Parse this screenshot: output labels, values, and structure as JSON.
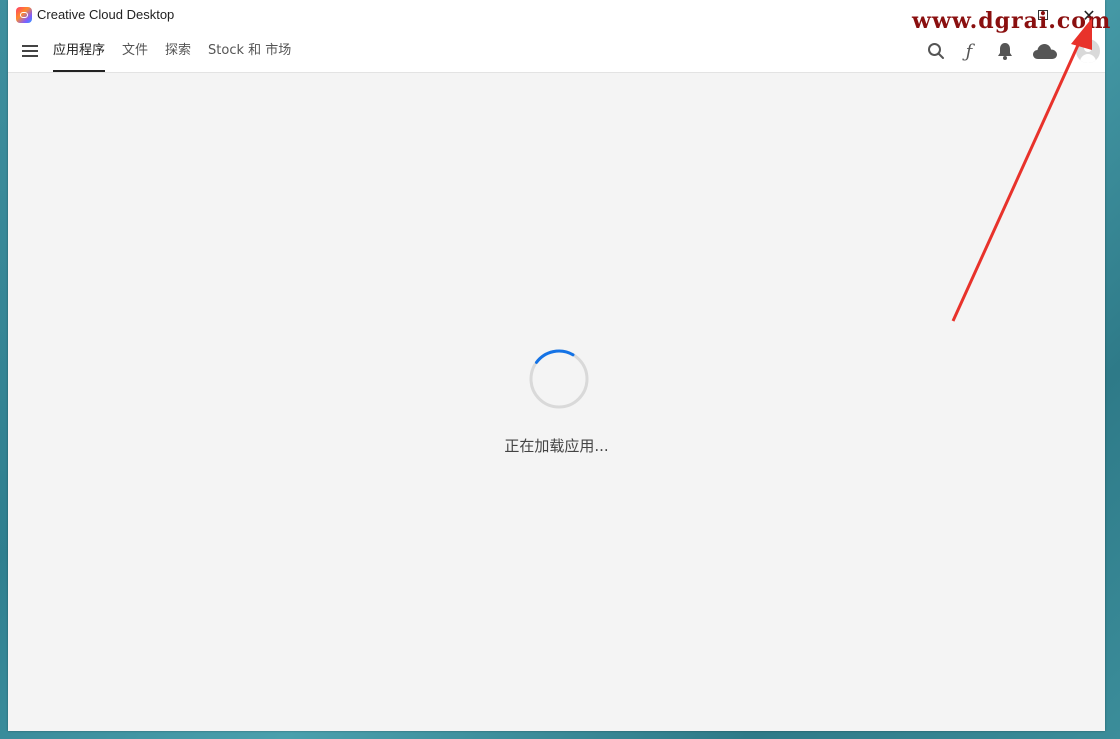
{
  "window": {
    "title": "Creative Cloud Desktop",
    "watermark": "www.dgrai.com"
  },
  "nav": {
    "tabs": [
      {
        "label": "应用程序",
        "active": true
      },
      {
        "label": "文件",
        "active": false
      },
      {
        "label": "探索",
        "active": false
      },
      {
        "label": "Stock 和 市场",
        "active": false
      }
    ],
    "icons": [
      "menu-icon",
      "search-icon",
      "fonts-icon",
      "bell-icon",
      "cloud-icon",
      "avatar"
    ]
  },
  "main": {
    "loading_text": "正在加载应用..."
  },
  "colors": {
    "spinner_accent": "#1473e6",
    "annotation_arrow": "#e8322b",
    "watermark": "#8a0f0f"
  }
}
